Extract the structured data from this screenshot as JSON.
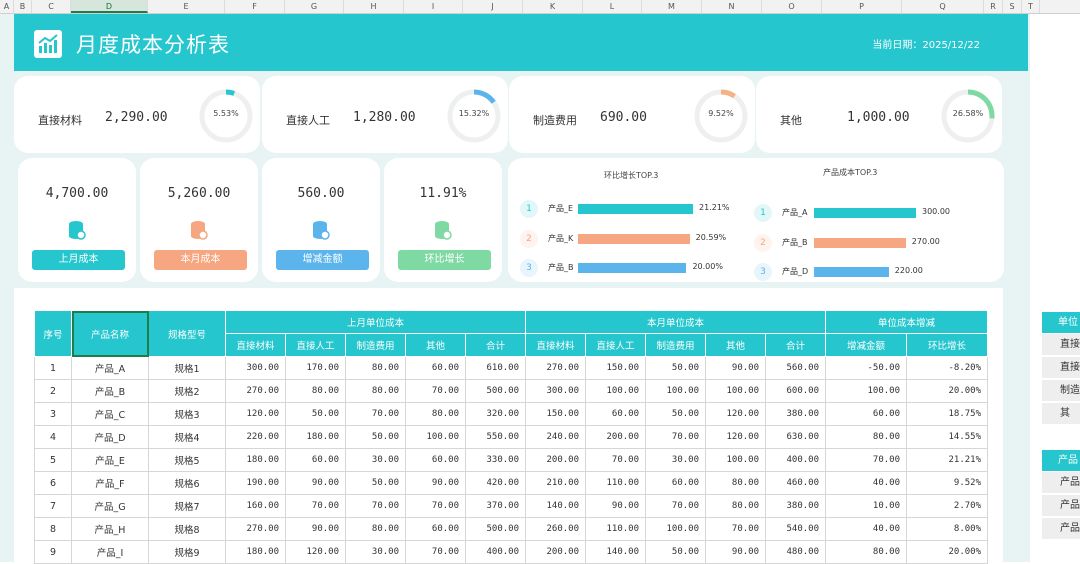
{
  "column_headers": [
    "A",
    "B",
    "C",
    "D",
    "E",
    "F",
    "G",
    "H",
    "I",
    "J",
    "K",
    "L",
    "M",
    "N",
    "O",
    "P",
    "Q",
    "R",
    "S",
    "T"
  ],
  "header": {
    "title": "月度成本分析表",
    "date_label": "当前日期：",
    "date_value": "2025/12/22"
  },
  "kpis": [
    {
      "label": "直接材料",
      "value": "2,290.00",
      "pct": "5.53%",
      "pct_value": 5.53,
      "color": "#26c6ce"
    },
    {
      "label": "直接人工",
      "value": "1,280.00",
      "pct": "15.32%",
      "pct_value": 15.32,
      "color": "#5bb4ec"
    },
    {
      "label": "制造费用",
      "value": "690.00",
      "pct": "9.52%",
      "pct_value": 9.52,
      "color": "#f6b187"
    },
    {
      "label": "其他",
      "value": "1,000.00",
      "pct": "26.58%",
      "pct_value": 26.58,
      "color": "#7ed9a2"
    }
  ],
  "summary": [
    {
      "value": "4,700.00",
      "label": "上月成本",
      "color": "#26c6ce"
    },
    {
      "value": "5,260.00",
      "label": "本月成本",
      "color": "#f6a681"
    },
    {
      "value": "560.00",
      "label": "增减金额",
      "color": "#5bb4ec"
    },
    {
      "value": "11.91%",
      "label": "环比增长",
      "color": "#7ed9a2"
    }
  ],
  "top_growth": {
    "title": "环比增长TOP.3",
    "items": [
      {
        "rank": "1",
        "name": "产品_E",
        "value": "21.21%",
        "num": 21.21,
        "color": "#26c6ce"
      },
      {
        "rank": "2",
        "name": "产品_K",
        "value": "20.59%",
        "num": 20.59,
        "color": "#f6a681"
      },
      {
        "rank": "3",
        "name": "产品_B",
        "value": "20.00%",
        "num": 20.0,
        "color": "#5bb4ec"
      }
    ]
  },
  "top_cost": {
    "title": "产品成本TOP.3",
    "items": [
      {
        "rank": "1",
        "name": "产品_A",
        "value": "300.00",
        "num": 300,
        "color": "#26c6ce"
      },
      {
        "rank": "2",
        "name": "产品_B",
        "value": "270.00",
        "num": 270,
        "color": "#f6a681"
      },
      {
        "rank": "3",
        "name": "产品_D",
        "value": "220.00",
        "num": 220,
        "color": "#5bb4ec"
      }
    ]
  },
  "table": {
    "h_seq": "序号",
    "h_name": "产品名称",
    "h_model": "规格型号",
    "h_last": "上月单位成本",
    "h_this": "本月单位成本",
    "h_change": "单位成本增减",
    "sub_last": [
      "直接材料",
      "直接人工",
      "制造费用",
      "其他",
      "合计"
    ],
    "sub_this": [
      "直接材料",
      "直接人工",
      "制造费用",
      "其他",
      "合计"
    ],
    "sub_change": [
      "增减金额",
      "环比增长"
    ],
    "rows": [
      [
        "1",
        "产品_A",
        "规格1",
        "300.00",
        "170.00",
        "80.00",
        "60.00",
        "610.00",
        "270.00",
        "150.00",
        "50.00",
        "90.00",
        "560.00",
        "-50.00",
        "-8.20%"
      ],
      [
        "2",
        "产品_B",
        "规格2",
        "270.00",
        "80.00",
        "80.00",
        "70.00",
        "500.00",
        "300.00",
        "100.00",
        "100.00",
        "100.00",
        "600.00",
        "100.00",
        "20.00%"
      ],
      [
        "3",
        "产品_C",
        "规格3",
        "120.00",
        "50.00",
        "70.00",
        "80.00",
        "320.00",
        "150.00",
        "60.00",
        "50.00",
        "120.00",
        "380.00",
        "60.00",
        "18.75%"
      ],
      [
        "4",
        "产品_D",
        "规格4",
        "220.00",
        "180.00",
        "50.00",
        "100.00",
        "550.00",
        "240.00",
        "200.00",
        "70.00",
        "120.00",
        "630.00",
        "80.00",
        "14.55%"
      ],
      [
        "5",
        "产品_E",
        "规格5",
        "180.00",
        "60.00",
        "30.00",
        "60.00",
        "330.00",
        "200.00",
        "70.00",
        "30.00",
        "100.00",
        "400.00",
        "70.00",
        "21.21%"
      ],
      [
        "6",
        "产品_F",
        "规格6",
        "190.00",
        "90.00",
        "50.00",
        "90.00",
        "420.00",
        "210.00",
        "110.00",
        "60.00",
        "80.00",
        "460.00",
        "40.00",
        "9.52%"
      ],
      [
        "7",
        "产品_G",
        "规格7",
        "160.00",
        "70.00",
        "70.00",
        "70.00",
        "370.00",
        "140.00",
        "90.00",
        "70.00",
        "80.00",
        "380.00",
        "10.00",
        "2.70%"
      ],
      [
        "8",
        "产品_H",
        "规格8",
        "270.00",
        "90.00",
        "80.00",
        "60.00",
        "500.00",
        "260.00",
        "110.00",
        "100.00",
        "70.00",
        "540.00",
        "40.00",
        "8.00%"
      ],
      [
        "9",
        "产品_I",
        "规格9",
        "180.00",
        "120.00",
        "30.00",
        "70.00",
        "400.00",
        "200.00",
        "140.00",
        "50.00",
        "90.00",
        "480.00",
        "80.00",
        "20.00%"
      ]
    ]
  },
  "side_panel": {
    "hdr1": "单位",
    "rows1": [
      "直接",
      "直接",
      "制造",
      "其"
    ],
    "hdr2": "产品",
    "rows2": [
      "产品",
      "产品",
      "产品"
    ]
  }
}
